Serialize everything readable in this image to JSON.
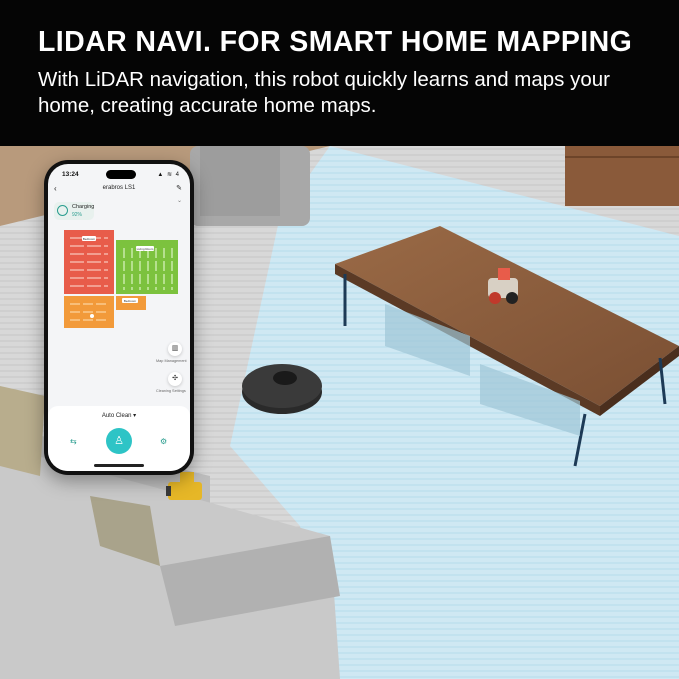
{
  "banner": {
    "headline": "LIDAR NAVI. FOR SMART HOME MAPPING",
    "subline": "With LiDAR navigation, this robot quickly learns and maps your home, creating accurate home maps."
  },
  "phone": {
    "status_time": "13:24",
    "status_icons": "▲ ≋ 4",
    "app_title": "erabros LS1",
    "back_icon": "‹",
    "edit_icon": "✎",
    "expand_icon": "⌄",
    "robot_status": "Charging",
    "battery": "92%",
    "rooms": [
      "Bedroom",
      "Living Room",
      "Bedroom"
    ],
    "side_buttons": [
      {
        "icon": "map-icon",
        "glyph": "▥",
        "label": "Map Management"
      },
      {
        "icon": "clean-settings-icon",
        "glyph": "✣",
        "label": "Cleaning Settings"
      }
    ],
    "mode_label": "Auto Clean ▾",
    "start_glyph": "♙",
    "left_glyph": "⇆",
    "right_glyph": "⚙"
  },
  "colors": {
    "banner_bg": "#050505",
    "accent_teal": "#2ec4c6",
    "room_red": "#e85c4a",
    "room_green": "#7cc23e",
    "room_orange": "#f29a3a",
    "floor_blue": "#8fd0ea"
  }
}
